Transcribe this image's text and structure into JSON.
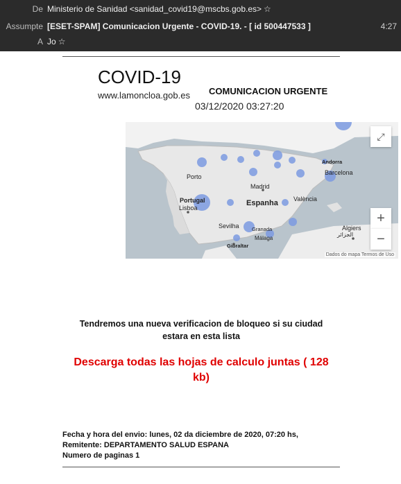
{
  "email_header": {
    "from_label": "De",
    "from_value": "Ministerio de Sanidad <sanidad_covid19@mscbs.gob.es>",
    "subject_label": "Assumpte",
    "subject_value": "[ESET-SPAM] Comunicacion Urgente - COVID-19. - [ id 500447533 ]",
    "time": "4:27",
    "to_label": "A",
    "to_value": "Jo"
  },
  "body": {
    "title": "COVID-19",
    "site": "www.lamoncloa.gob.es",
    "urgent": "COMUNICACION URGENTE",
    "datetime": "03/12/2020 03:27:20",
    "map": {
      "places": {
        "andorra": "Andorra",
        "barcelona": "Barcelona",
        "porto": "Porto",
        "madrid": "Madrid",
        "portugal": "Portugal",
        "espanha": "Espanha",
        "valencia": "València",
        "lisboa": "Lisboa",
        "sevilha": "Sevilha",
        "granada": "Granada",
        "algiers": "Algiers",
        "algiers_ar": "الجزائر",
        "malaga": "Málaga",
        "gibraltar": "Gibraltar"
      },
      "zoom_in": "+",
      "zoom_out": "−",
      "attribution": "Dados do mapa    Termos de Uso"
    },
    "message": "Tendremos una nueva verificacion de bloqueo si su ciudad estara en esta lista",
    "download_link": "Descarga todas las hojas de calculo juntas ( 128 kb)",
    "footer": {
      "line1": "Fecha y hora del envio: lunes, 02 da diciembre de 2020, 07:20 hs,",
      "line2": "Remitente: DEPARTAMENTO SALUD ESPANA",
      "line3": "Numero de paginas 1"
    }
  }
}
